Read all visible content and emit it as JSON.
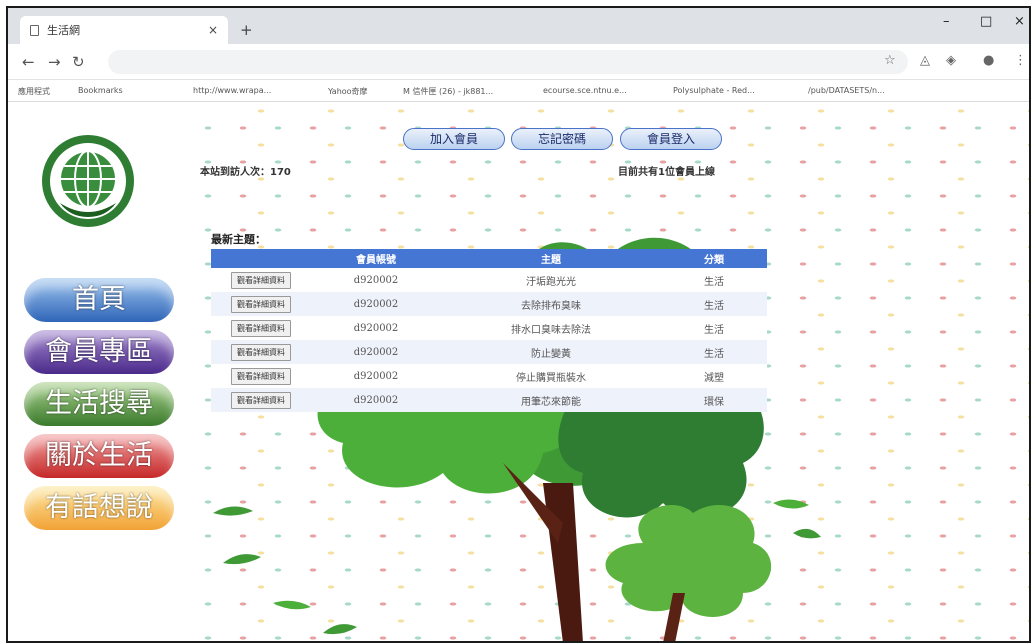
{
  "browser": {
    "tab_title": "生活網",
    "tab_close": "×",
    "new_tab": "+",
    "min": "–",
    "max": "□",
    "close": "×",
    "bookmarks": [
      "應用程式",
      "Bookmarks",
      "http://www.wrapa...",
      "Yahoo奇摩",
      "M 信件匣 (26) - jk881...",
      "ecourse.sce.ntnu.e...",
      "Polysulphate - Red...",
      "/pub/DATASETS/n..."
    ]
  },
  "sidebar": {
    "menu": [
      "首頁",
      "會員專區",
      "生活搜尋",
      "關於生活",
      "有話想說"
    ]
  },
  "header": {
    "buttons": [
      "加入會員",
      "忘記密碼",
      "會員登入"
    ],
    "visit_count": "本站到訪人次：170",
    "online": "目前共有1位會員上線"
  },
  "topics": {
    "heading": "最新主題：",
    "columns": [
      "",
      "會員帳號",
      "主題",
      "分類"
    ],
    "detail_label": "觀看詳細資料",
    "rows": [
      {
        "account": "d920002",
        "topic": "汙垢跑光光",
        "category": "生活"
      },
      {
        "account": "d920002",
        "topic": "去除排布臭味",
        "category": "生活"
      },
      {
        "account": "d920002",
        "topic": "排水口臭味去除法",
        "category": "生活"
      },
      {
        "account": "d920002",
        "topic": "防止變黃",
        "category": "生活"
      },
      {
        "account": "d920002",
        "topic": "停止購買瓶裝水",
        "category": "減塑"
      },
      {
        "account": "d920002",
        "topic": "用筆芯來節能",
        "category": "環保"
      }
    ]
  }
}
